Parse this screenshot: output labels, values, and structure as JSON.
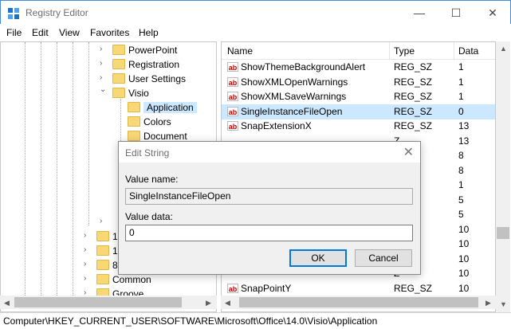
{
  "window": {
    "title": "Registry Editor",
    "min": "—",
    "max": "☐",
    "close": "✕"
  },
  "menu": [
    "File",
    "Edit",
    "View",
    "Favorites",
    "Help"
  ],
  "tree": {
    "items": [
      {
        "label": "PowerPoint",
        "chev": "›"
      },
      {
        "label": "Registration",
        "chev": "›"
      },
      {
        "label": "User Settings",
        "chev": "›"
      },
      {
        "label": "Visio",
        "chev": "⌄"
      },
      {
        "label": "Application",
        "chev": ""
      },
      {
        "label": "Colors",
        "chev": ""
      },
      {
        "label": "Document",
        "chev": ""
      }
    ],
    "lower": [
      {
        "label": "1",
        "chev": "›"
      },
      {
        "label": "1",
        "chev": "›"
      },
      {
        "label": "8",
        "chev": "›"
      },
      {
        "label": "Common",
        "chev": "›"
      },
      {
        "label": "Groove",
        "chev": "›"
      }
    ]
  },
  "list": {
    "columns": {
      "name": "Name",
      "type": "Type",
      "data": "Data"
    },
    "rows": [
      {
        "name": "ShowThemeBackgroundAlert",
        "type": "REG_SZ",
        "data": "1"
      },
      {
        "name": "ShowXMLOpenWarnings",
        "type": "REG_SZ",
        "data": "1"
      },
      {
        "name": "ShowXMLSaveWarnings",
        "type": "REG_SZ",
        "data": "1"
      },
      {
        "name": "SingleInstanceFileOpen",
        "type": "REG_SZ",
        "data": "0"
      },
      {
        "name": "SnapExtensionX",
        "type": "REG_SZ",
        "data": "13"
      },
      {
        "name": "",
        "type": "Z",
        "data": "13"
      },
      {
        "name": "",
        "type": "Z",
        "data": "8"
      },
      {
        "name": "",
        "type": "Z",
        "data": "8"
      },
      {
        "name": "",
        "type": "Z",
        "data": "1"
      },
      {
        "name": "",
        "type": "Z",
        "data": "5"
      },
      {
        "name": "",
        "type": "Z",
        "data": "5"
      },
      {
        "name": "",
        "type": "Z",
        "data": "10"
      },
      {
        "name": "",
        "type": "Z",
        "data": "10"
      },
      {
        "name": "",
        "type": "Z",
        "data": "10"
      },
      {
        "name": "",
        "type": "Z",
        "data": "10"
      },
      {
        "name": "SnapPointY",
        "type": "REG_SZ",
        "data": "10"
      }
    ]
  },
  "status": "Computer\\HKEY_CURRENT_USER\\SOFTWARE\\Microsoft\\Office\\14.0\\Visio\\Application",
  "dialog": {
    "title": "Edit String",
    "close": "✕",
    "value_name_label": "Value name:",
    "value_name": "SingleInstanceFileOpen",
    "value_data_label": "Value data:",
    "value_data": "0",
    "ok": "OK",
    "cancel": "Cancel"
  }
}
